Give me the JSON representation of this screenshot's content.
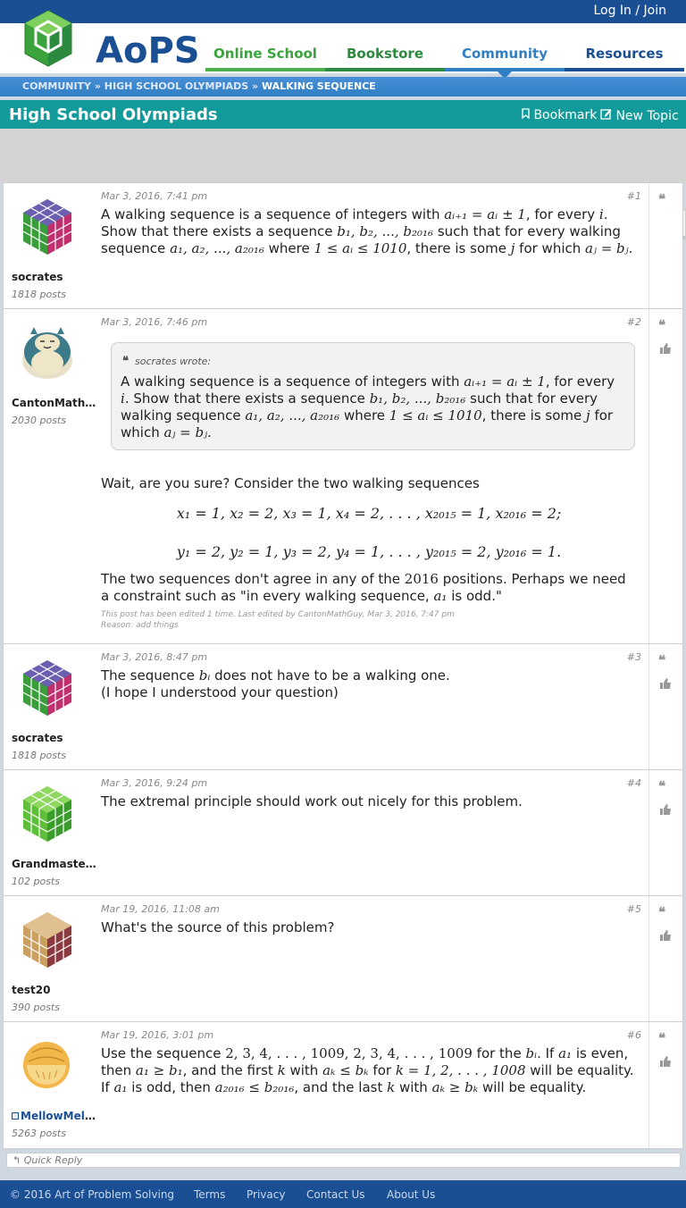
{
  "header": {
    "login": "Log In / Join",
    "logo_text": "AoPS",
    "nav": [
      "Online School",
      "Bookstore",
      "Community",
      "Resources"
    ]
  },
  "breadcrumb": [
    "COMMUNITY",
    "HIGH SCHOOL OLYMPIADS",
    "WALKING SEQUENCE"
  ],
  "forum": {
    "title": "High School Olympiads",
    "bookmark": "Bookmark",
    "new_topic": "New Topic"
  },
  "posts": [
    {
      "num": "#1",
      "date": "Mar 3, 2016, 7:41 pm",
      "user": "socrates",
      "count": "1818 posts",
      "text": {
        "t1": "A walking sequence is a sequence of integers with ",
        "t2": ", for every ",
        "t3": ". Show that there exists a sequence ",
        "t4": " such that for every walking sequence ",
        "t5": " where ",
        "t6": ", there is some ",
        "t7": " for which "
      }
    },
    {
      "num": "#2",
      "date": "Mar 3, 2016, 7:46 pm",
      "user": "CantonMathGuy",
      "count": "2030 posts",
      "quote_head": "socrates wrote:",
      "text": {
        "a": "Wait, are you sure? Consider the two walking sequences",
        "b1": "The two sequences don't agree in any of the ",
        "b2": " positions. Perhaps we need a constraint such as \"in every walking sequence, ",
        "b3": " is odd.\"",
        "edit1": "This post has been edited 1 time. Last edited by CantonMathGuy, Mar 3, 2016, 7:47 pm",
        "edit2": "Reason: add things"
      }
    },
    {
      "num": "#3",
      "date": "Mar 3, 2016, 8:47 pm",
      "user": "socrates",
      "count": "1818 posts",
      "text": {
        "a1": "The sequence ",
        "a2": " does not have to be a walking one.",
        "b": "(I hope I understood your question)"
      }
    },
    {
      "num": "#4",
      "date": "Mar 3, 2016, 9:24 pm",
      "user": "Grandmaster…",
      "count": "102 posts",
      "text": {
        "a": "The extremal principle should work out nicely for this problem."
      }
    },
    {
      "num": "#5",
      "date": "Mar 19, 2016, 11:08 am",
      "user": "test20",
      "count": "390 posts",
      "text": {
        "a": "What's the source of this problem?"
      }
    },
    {
      "num": "#6",
      "date": "Mar 19, 2016, 3:01 pm",
      "user": "MellowMelon",
      "count": "5263 posts",
      "text": {
        "t1": "Use the sequence ",
        "t2": " for the ",
        "t3": ". If ",
        "t4": " is even, then ",
        "t5": ", and the first ",
        "t6": " with ",
        "t7": " for ",
        "t8": " will be equality. If ",
        "t9": " is odd, then ",
        "t10": ", and the last ",
        "t11": " with ",
        "t12": " will be equality."
      }
    }
  ],
  "math": {
    "rec": "aᵢ₊₁ = aᵢ ± 1",
    "i": "i",
    "j": "j",
    "k": "k",
    "bseq": "b₁, b₂, ..., b₂₀₁₆",
    "aseq": "a₁, a₂, ..., a₂₀₁₆",
    "range": "1 ≤ aᵢ ≤ 1010",
    "eq": "aⱼ = bⱼ.",
    "eq2": "aⱼ = bⱼ.",
    "xseq": "x₁ = 1, x₂ = 2, x₃ = 1, x₄ = 2, . . . , x₂₀₁₅ = 1, x₂₀₁₆ = 2;",
    "yseq": "y₁ = 2, y₂ = 1, y₃ = 2, y₄ = 1, . . . , y₂₀₁₅ = 2, y₂₀₁₆ = 1.",
    "n2016": "2016",
    "a1": "a₁",
    "bi": "bᵢ",
    "seq6": "2, 3, 4, . . . , 1009, 2, 3, 4, . . . , 1009",
    "ge": "a₁ ≥ b₁",
    "akbk": "aₖ ≤ bₖ",
    "krange": "k = 1, 2, . . . , 1008",
    "last": "a₂₀₁₆ ≤ b₂₀₁₆",
    "akbk2": "aₖ ≥ bₖ"
  },
  "quick_reply": "Quick Reply",
  "footer": [
    "© 2016 Art of Problem Solving",
    "Terms",
    "Privacy",
    "Contact Us",
    "About Us"
  ],
  "colors": {
    "brand": "#1b4f93",
    "forum_bar": "#139a9a",
    "community": "#2f7fc4"
  }
}
